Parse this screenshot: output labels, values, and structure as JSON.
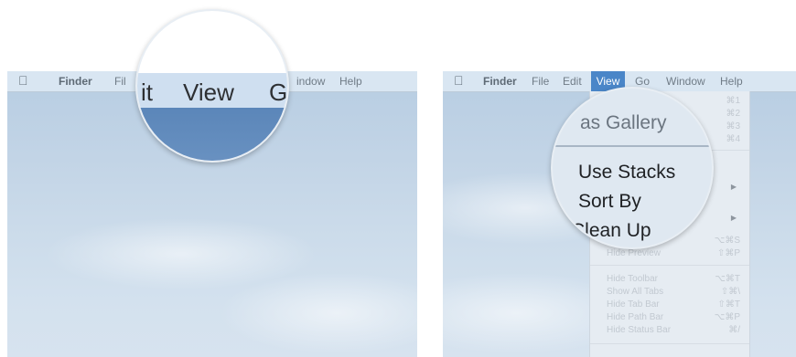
{
  "left": {
    "menubar": {
      "app_name": "Finder",
      "items": [
        "File",
        "Edit",
        "View",
        "Go",
        "Window",
        "Help"
      ],
      "visible_file_fragment": "Fil",
      "visible_window_fragment": "indow"
    },
    "magnifier": {
      "text_it": "it",
      "text_view": "View",
      "text_g": "G"
    }
  },
  "right": {
    "menubar": {
      "app_name": "Finder",
      "items": [
        "File",
        "Edit",
        "View",
        "Go",
        "Window",
        "Help"
      ],
      "active": "View"
    },
    "menu": {
      "shortcuts_top": [
        "⌘1",
        "⌘2",
        "⌘3",
        "⌘4"
      ],
      "clean_up_shortcut": "⌥⌘S",
      "hide_preview": {
        "label": "Hide Preview",
        "shortcut": "⇧⌘P"
      },
      "group": [
        {
          "label": "Hide Toolbar",
          "shortcut": "⌥⌘T"
        },
        {
          "label": "Show All Tabs",
          "shortcut": "⇧⌘\\"
        },
        {
          "label": "Hide Tab Bar",
          "shortcut": "⇧⌘T"
        },
        {
          "label": "Hide Path Bar",
          "shortcut": "⌥⌘P"
        },
        {
          "label": "Hide Status Bar",
          "shortcut": "⌘/"
        }
      ]
    },
    "magnifier": {
      "as_gallery": "as Gallery",
      "use_stacks": "Use Stacks",
      "sort_by": "Sort By",
      "clean_up": "Clean Up"
    }
  },
  "icons": {
    "apple": "apple-logo-icon",
    "submenu_arrow": "triangle-right-icon"
  }
}
